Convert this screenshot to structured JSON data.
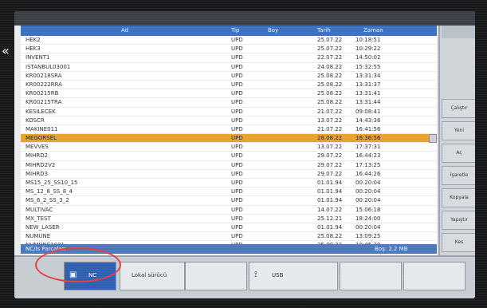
{
  "table": {
    "headers": {
      "name": "Ad",
      "type": "Tip",
      "size": "Boy",
      "date": "Tarih",
      "time": "Zaman"
    },
    "rows": [
      {
        "name": "HEK2",
        "type": "UPD",
        "date": "25.07.22",
        "time": "10:18:51"
      },
      {
        "name": "HEK3",
        "type": "UPD",
        "date": "25.07.22",
        "time": "10:29:22"
      },
      {
        "name": "INVENT1",
        "type": "UPD",
        "date": "22.07.22",
        "time": "14:50:02"
      },
      {
        "name": "ISTANBUL03001",
        "type": "UPD",
        "date": "24.08.22",
        "time": "15:32:55"
      },
      {
        "name": "KR00218SRA",
        "type": "UPD",
        "date": "25.08.22",
        "time": "13:31:34"
      },
      {
        "name": "KR00222RRA",
        "type": "UPD",
        "date": "25.08.22",
        "time": "13:31:37"
      },
      {
        "name": "KR00215RB",
        "type": "UPD",
        "date": "25.08.22",
        "time": "13:31:41"
      },
      {
        "name": "KR00215TRA",
        "type": "UPD",
        "date": "25.08.22",
        "time": "13:31:44"
      },
      {
        "name": "KESILECEK",
        "type": "UPD",
        "date": "21.07.22",
        "time": "09:08:41"
      },
      {
        "name": "KOSCR",
        "type": "UPD",
        "date": "13.07.22",
        "time": "14:43:36"
      },
      {
        "name": "MAKINE011",
        "type": "UPD",
        "date": "21.07.22",
        "time": "16:41:56"
      },
      {
        "name": "MEGORSEL",
        "type": "UPD",
        "date": "28.08.22",
        "time": "16:36:56",
        "selected": true
      },
      {
        "name": "MEVVES",
        "type": "UPD",
        "date": "13.07.22",
        "time": "17:37:31"
      },
      {
        "name": "MIHRD2",
        "type": "UPD",
        "date": "29.07.22",
        "time": "16:44:23"
      },
      {
        "name": "MIHRD2V2",
        "type": "UPD",
        "date": "29.07.22",
        "time": "17:13:25"
      },
      {
        "name": "MIHRD3",
        "type": "UPD",
        "date": "29.07.22",
        "time": "16:44:26"
      },
      {
        "name": "MS15_25_SS10_15",
        "type": "UPD",
        "date": "01.01.94",
        "time": "00:20:04"
      },
      {
        "name": "MS_12_8_SS_8_4",
        "type": "UPD",
        "date": "01.01.94",
        "time": "00:20:04"
      },
      {
        "name": "MS_6_2_SS_3_2",
        "type": "UPD",
        "date": "01.01.94",
        "time": "00:20:04"
      },
      {
        "name": "MULTIVAC",
        "type": "UPD",
        "date": "14.07.22",
        "time": "15:06:18"
      },
      {
        "name": "MX_TEST",
        "type": "UPD",
        "date": "25.12.21",
        "time": "18:24:00"
      },
      {
        "name": "NEW_LASER",
        "type": "UPD",
        "date": "01.01.94",
        "time": "00:20:04"
      },
      {
        "name": "NUMUNE",
        "type": "UPD",
        "date": "25.08.22",
        "time": "13:09:25"
      },
      {
        "name": "NUMUNE1001",
        "type": "UPD",
        "date": "25.08.22",
        "time": "10:45:39"
      }
    ]
  },
  "status": {
    "left": "NC/Is Parçaları",
    "right": "Boş: 2.2 MB"
  },
  "bottom": {
    "nc_label": "NC",
    "local_label": "Lokal sürücü",
    "usb_label": "USB"
  },
  "right_panel": {
    "buttons": [
      "Çalıştır",
      "Yeni",
      "Aç",
      "İşaretle",
      "Kopyala",
      "Yapıştır",
      "Kes",
      ">"
    ]
  },
  "colors": {
    "accent_blue": "#3b6fc0",
    "selected_row": "#e9a12c",
    "highlight_ellipse": "#e53b3b"
  },
  "icons": {
    "nc": "computer-icon",
    "usb": "usb-icon"
  }
}
